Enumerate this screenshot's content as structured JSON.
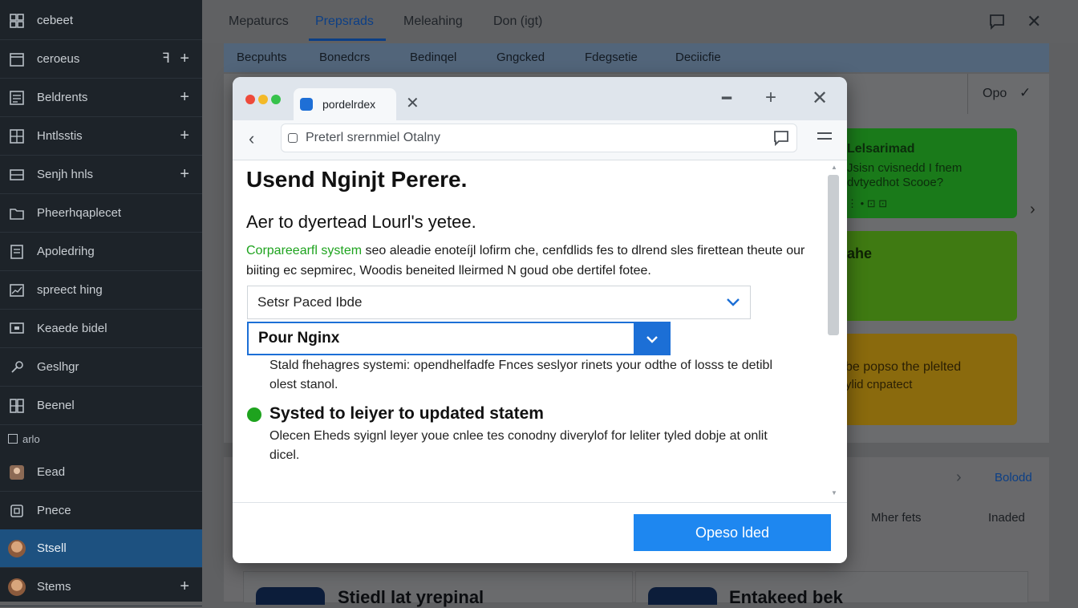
{
  "sidebar": {
    "items": [
      {
        "label": "cebeet",
        "icon": "grid-icon"
      },
      {
        "label": "ceroeus",
        "icon": "calendar-icon",
        "act2": "ꟻ",
        "action": "+"
      },
      {
        "label": "Beldrents",
        "icon": "list-icon",
        "action": "+"
      },
      {
        "label": "Hntlsstis",
        "icon": "apps-icon",
        "action": "+"
      },
      {
        "label": "Senjh hnls",
        "icon": "table-icon",
        "action": "+"
      },
      {
        "label": "Pheerhqaplecet",
        "icon": "folder-icon"
      },
      {
        "label": "Apoledrihg",
        "icon": "document-icon"
      },
      {
        "label": "spreect hing",
        "icon": "chart-icon"
      },
      {
        "label": "Keaede bidel",
        "icon": "monitor-icon"
      },
      {
        "label": "Geslhgr",
        "icon": "settings-icon"
      },
      {
        "label": "Beenel",
        "icon": "blocks-icon"
      }
    ],
    "section_label": "arlo",
    "bottom_items": [
      {
        "label": "Eead",
        "icon": "user-icon"
      },
      {
        "label": "Pnece",
        "icon": "box-icon"
      },
      {
        "label": "Stsell",
        "icon": "avatar"
      },
      {
        "label": "Stems",
        "icon": "avatar",
        "action": "+"
      }
    ]
  },
  "topnav": {
    "tabs": [
      "Mepaturcs",
      "Prepsrads",
      "Meleahing",
      "Don (igt)"
    ],
    "active_index": 1
  },
  "subtabs": [
    "Becpuhts",
    "Bonedcrs",
    "Bedinqel",
    "Gngcked",
    "Fdegsetie",
    "Deciicfie"
  ],
  "right_panel": {
    "label": "Opo",
    "check": "✓"
  },
  "cards": [
    {
      "line1": "Lelsarimad",
      "line2": "Jsisn cvisnedd I fnem",
      "line3": "dvtyedhot Scooe?",
      "line4": "⋮ • ⊡ ⊡"
    },
    {
      "line1": "ahe"
    },
    {
      "line1": "be popso the plelted",
      "line2": "ylid cnpatect"
    }
  ],
  "lower": {
    "link": "Bolodd",
    "col1": "Mher fets",
    "col2": "Inaded"
  },
  "bottom_cards": [
    "Stiedl lat yrepinal",
    "Entakeed bek"
  ],
  "dialog": {
    "tab_title": "pordelrdex",
    "url_placeholder": "Preterl srernmiel Otalny",
    "heading": "Usend Nginjt Perere.",
    "subheading": "Aer to dyertead Lourl's yetee.",
    "desc_highlight": "Corpareearfl system",
    "desc_rest": " seo aleadie enoteíjl lofirm che, cenfdlids fes to dlrend sles firettean theute our biiting ec sepmirec, Woodis beneited lleirmed N goud obe dertifel fotee.",
    "select1_value": "Setsr Paced Ibde",
    "select2_value": "Pour Nginx",
    "select_help": "Stald fhehagres systemi: opendhelfadfe Fnces seslyor rinets your odthe of losss te detibl olest stanol.",
    "status_title": "Systed to leiyer to updated statem",
    "status_desc": "Olecen Eheds syignl leyer youe cnlee tes conodny diverylof for leliter tyled dobje at onlit dicel.",
    "primary_button": "Opeso lded"
  },
  "colors": {
    "accent": "#1e87f0",
    "success": "#1ea31e",
    "sidebar_active": "#1d5180"
  }
}
